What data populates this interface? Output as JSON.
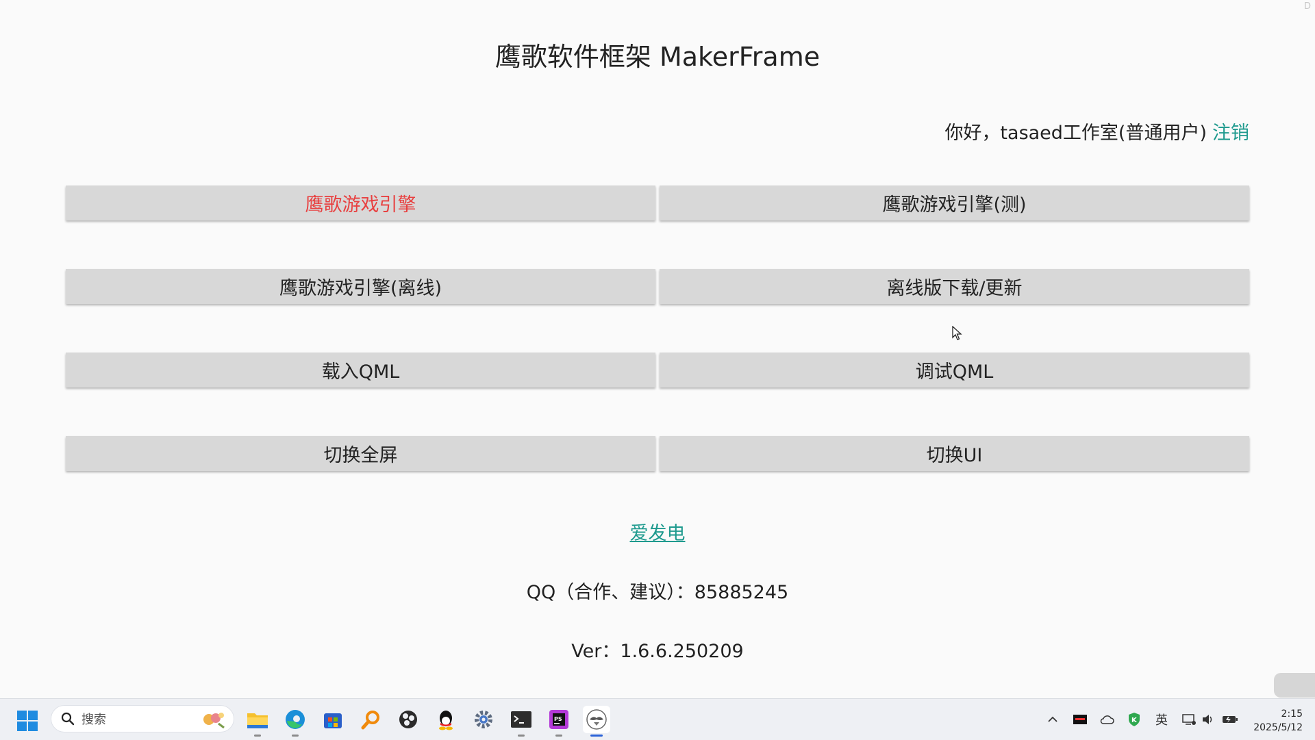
{
  "window": {
    "corner_mark": "D"
  },
  "header": {
    "title": "鹰歌软件框架 MakerFrame",
    "greeting": "你好，tasaed工作室(普通用户)",
    "logout_label": "注销"
  },
  "menu": {
    "buttons": [
      {
        "label": "鹰歌游戏引擎",
        "color": "#e84040"
      },
      {
        "label": "鹰歌游戏引擎(测)"
      },
      {
        "label": "鹰歌游戏引擎(离线)"
      },
      {
        "label": "离线版下载/更新"
      },
      {
        "label": "载入QML"
      },
      {
        "label": "调试QML"
      },
      {
        "label": "切换全屏"
      },
      {
        "label": "切换UI"
      }
    ]
  },
  "footer": {
    "donate_label": "爱发电",
    "qq_info": "QQ（合作、建议）：85885245",
    "version": "Ver：1.6.6.250209"
  },
  "colors": {
    "link": "#1e9a8e",
    "button_bg": "#d8d8d8",
    "primary_text": "#e84040"
  },
  "taskbar": {
    "search_placeholder": "搜索",
    "apps": [
      "file-explorer-icon",
      "edge-icon",
      "store-icon",
      "search-tool-icon",
      "obs-icon",
      "qq-icon",
      "settings-icon",
      "terminal-icon",
      "phpstorm-icon",
      "makerframe-icon"
    ],
    "tray": {
      "ime_label": "英"
    },
    "clock": {
      "time": "2:15",
      "date": "2025/5/12"
    }
  }
}
